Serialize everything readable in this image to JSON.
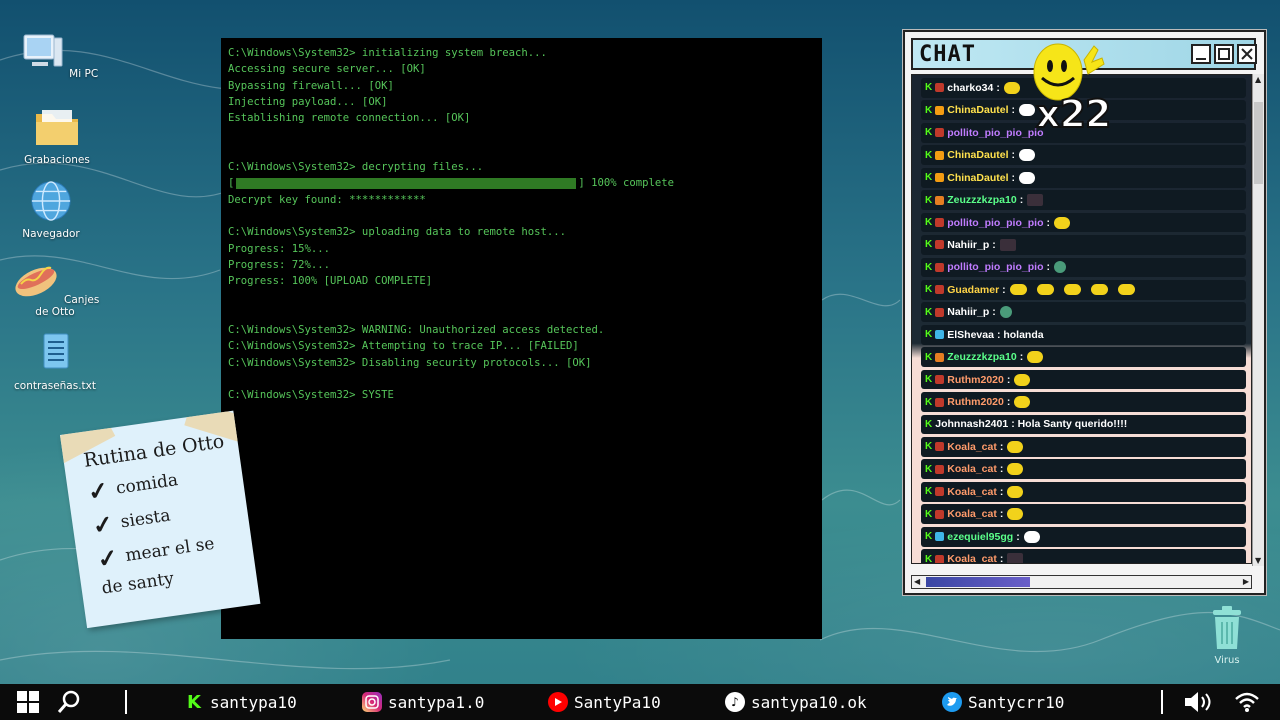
{
  "desktop": {
    "icons": [
      {
        "label": "Mi PC",
        "icon": "computer-icon"
      },
      {
        "label": "Grabaciones",
        "icon": "folder-icon"
      },
      {
        "label": "Navegador",
        "icon": "globe-icon"
      },
      {
        "label": "Canjes de Otto",
        "icon": "hotdog-icon"
      },
      {
        "label": "contraseñas.txt",
        "icon": "text-file-icon"
      }
    ],
    "trash_label": "Virus"
  },
  "terminal": {
    "lines": [
      "C:\\Windows\\System32> initializing system breach...",
      "Accessing secure server... [OK]",
      "Bypassing firewall... [OK]",
      "Injecting payload... [OK]",
      "Establishing remote connection... [OK]",
      "",
      "",
      "C:\\Windows\\System32> decrypting files...",
      "__PROGRESS__",
      "Decrypt key found: ************",
      "",
      "C:\\Windows\\System32> uploading data to remote host...",
      "Progress: 15%...",
      "Progress: 72%...",
      "Progress: 100% [UPLOAD COMPLETE]",
      "",
      "",
      "C:\\Windows\\System32> WARNING: Unauthorized access detected.",
      "C:\\Windows\\System32> Attempting to trace IP... [FAILED]",
      "C:\\Windows\\System32> Disabling security protocols... [OK]",
      "",
      "C:\\Windows\\System32> SYSTE"
    ],
    "progress_open": "[",
    "progress_close": "] 100% complete",
    "progress_fraction": 1.0
  },
  "note": {
    "title": "Rutina de Otto",
    "items": [
      "comida",
      "siesta",
      "mear el se"
    ],
    "footer": "de santy"
  },
  "chat": {
    "title": "CHAT",
    "overlay_count": "x22",
    "messages": [
      {
        "user": "charko34",
        "text": ":",
        "color": "#ffffff",
        "badge": "#c0392b",
        "emote": "smiley"
      },
      {
        "user": "ChinaDautel",
        "text": ":",
        "color": "#ffe14d",
        "badge": "#f39c12",
        "emote": "white"
      },
      {
        "user": "pollito_pio_pio_pio",
        "text": "",
        "color": "#c07cff",
        "badge": "#c0392b",
        "emote": "none"
      },
      {
        "user": "ChinaDautel",
        "text": ":",
        "color": "#ffe14d",
        "badge": "#f39c12",
        "emote": "white"
      },
      {
        "user": "ChinaDautel",
        "text": ":",
        "color": "#ffe14d",
        "badge": "#f39c12",
        "emote": "white"
      },
      {
        "user": "Zeuzzzkzpa10",
        "text": ":",
        "color": "#5bff8a",
        "badge": "#e67e22",
        "emote": "dark"
      },
      {
        "user": "pollito_pio_pio_pio",
        "text": ":",
        "color": "#c07cff",
        "badge": "#c0392b",
        "emote": "smiley"
      },
      {
        "user": "Nahiir_p",
        "text": ":",
        "color": "#ffffff",
        "badge": "#c0392b",
        "emote": "dark"
      },
      {
        "user": "pollito_pio_pio_pio",
        "text": ":",
        "color": "#c07cff",
        "badge": "#c0392b",
        "emote": "green"
      },
      {
        "user": "Guadamer",
        "text": ":",
        "color": "#ffd447",
        "badge": "#c0392b",
        "emote": "row5"
      },
      {
        "user": "Nahiir_p",
        "text": ":",
        "color": "#ffffff",
        "badge": "#c0392b",
        "emote": "green"
      },
      {
        "user": "ElShevaa",
        "text": ": holanda",
        "color": "#ffffff",
        "badge": "#3fb6e8",
        "emote": "none"
      },
      {
        "user": "Zeuzzzkzpa10",
        "text": ":",
        "color": "#5bff8a",
        "badge": "#e67e22",
        "emote": "smiley"
      },
      {
        "user": "Ruthm2020",
        "text": ":",
        "color": "#ff9b6b",
        "badge": "#c0392b",
        "emote": "smiley"
      },
      {
        "user": "Ruthm2020",
        "text": ":",
        "color": "#ff9b6b",
        "badge": "#c0392b",
        "emote": "smiley"
      },
      {
        "user": "Johnnash2401",
        "text": ": Hola Santy querido!!!!",
        "color": "#ffffff",
        "badge": "",
        "emote": "none"
      },
      {
        "user": "Koala_cat",
        "text": ":",
        "color": "#ff9b6b",
        "badge": "#c0392b",
        "emote": "smiley"
      },
      {
        "user": "Koala_cat",
        "text": ":",
        "color": "#ff9b6b",
        "badge": "#c0392b",
        "emote": "smiley"
      },
      {
        "user": "Koala_cat",
        "text": ":",
        "color": "#ff9b6b",
        "badge": "#c0392b",
        "emote": "smiley"
      },
      {
        "user": "Koala_cat",
        "text": ":",
        "color": "#ff9b6b",
        "badge": "#c0392b",
        "emote": "smiley"
      },
      {
        "user": "ezequiel95gg",
        "text": ":",
        "color": "#5bff8a",
        "badge": "#3fb6e8",
        "emote": "white"
      },
      {
        "user": "Koala_cat",
        "text": ":",
        "color": "#ff9b6b",
        "badge": "#c0392b",
        "emote": "dark"
      }
    ]
  },
  "taskbar": {
    "socials": [
      {
        "platform": "kick",
        "handle": "santypa10",
        "color": "#53fc18",
        "icon": "kick-icon"
      },
      {
        "platform": "instagram",
        "handle": "santypa1.0",
        "color": "#d6249f",
        "icon": "instagram-icon"
      },
      {
        "platform": "youtube",
        "handle": "SantyPa10",
        "color": "#ff0000",
        "icon": "youtube-icon"
      },
      {
        "platform": "tiktok",
        "handle": "santypa10.ok",
        "color": "#ffffff",
        "icon": "tiktok-icon"
      },
      {
        "platform": "twitter",
        "handle": "Santycrr10",
        "color": "#1d9bf0",
        "icon": "twitter-icon"
      }
    ]
  }
}
